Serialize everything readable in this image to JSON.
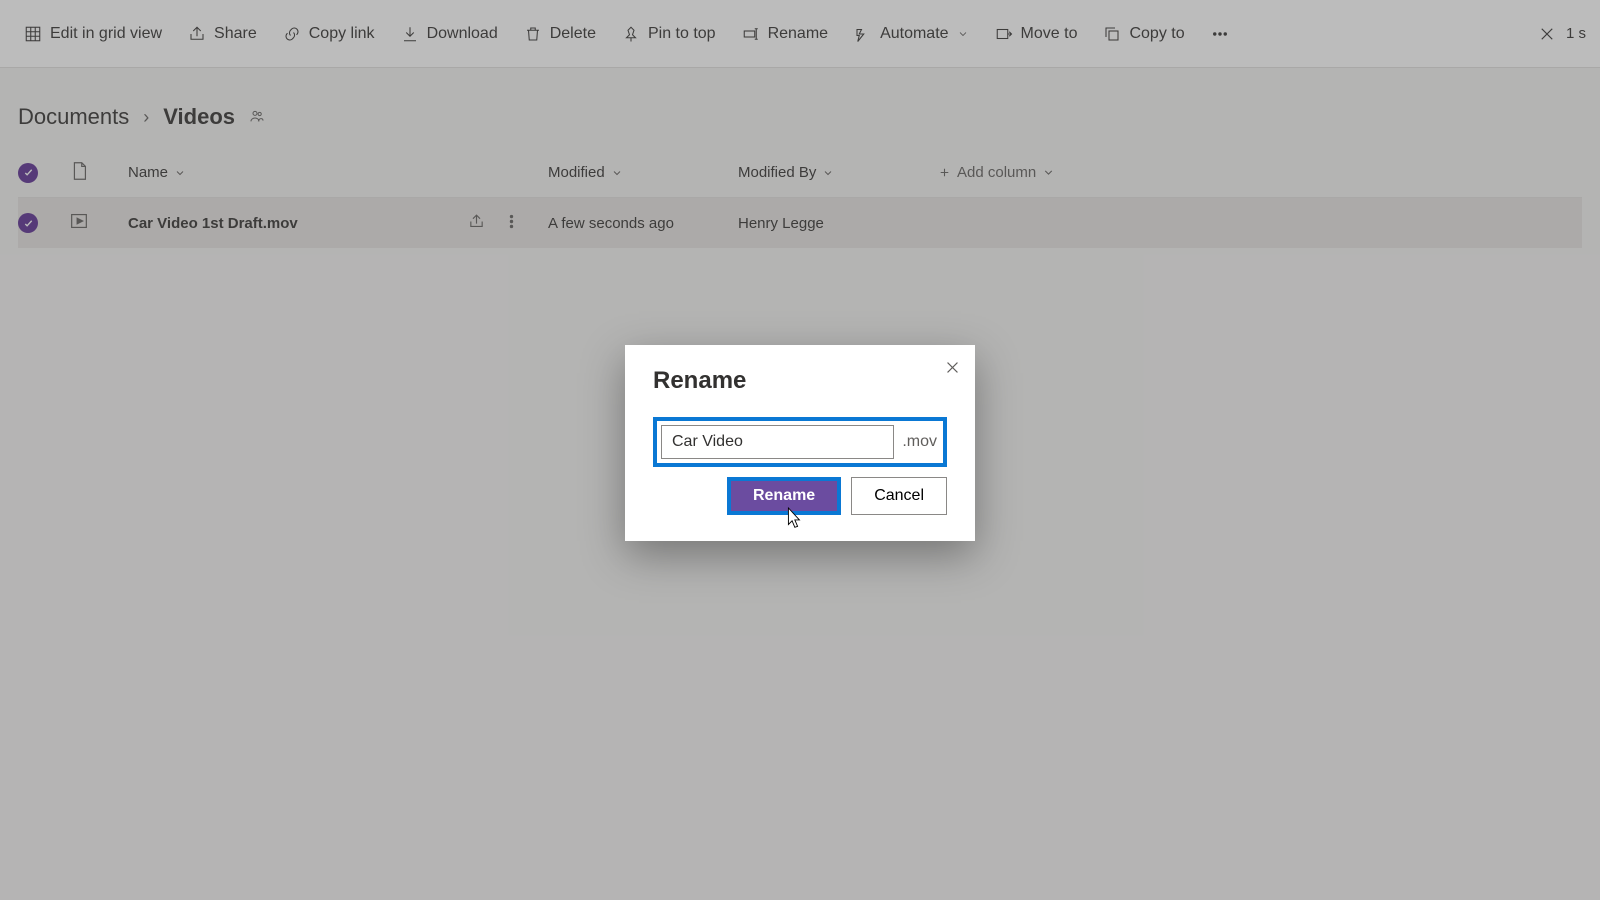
{
  "toolbar": {
    "edit_grid": "Edit in grid view",
    "share": "Share",
    "copy_link": "Copy link",
    "download": "Download",
    "delete": "Delete",
    "pin": "Pin to top",
    "rename": "Rename",
    "automate": "Automate",
    "move": "Move to",
    "copy": "Copy to",
    "selection_text": "1 s"
  },
  "breadcrumb": {
    "root": "Documents",
    "leaf": "Videos"
  },
  "columns": {
    "name": "Name",
    "modified": "Modified",
    "modified_by": "Modified By",
    "add": "Add column"
  },
  "row": {
    "name": "Car Video 1st Draft.mov",
    "modified": "A few seconds ago",
    "modified_by": "Henry Legge"
  },
  "dialog": {
    "title": "Rename",
    "value": "Car Video",
    "ext": ".mov",
    "primary": "Rename",
    "secondary": "Cancel"
  }
}
